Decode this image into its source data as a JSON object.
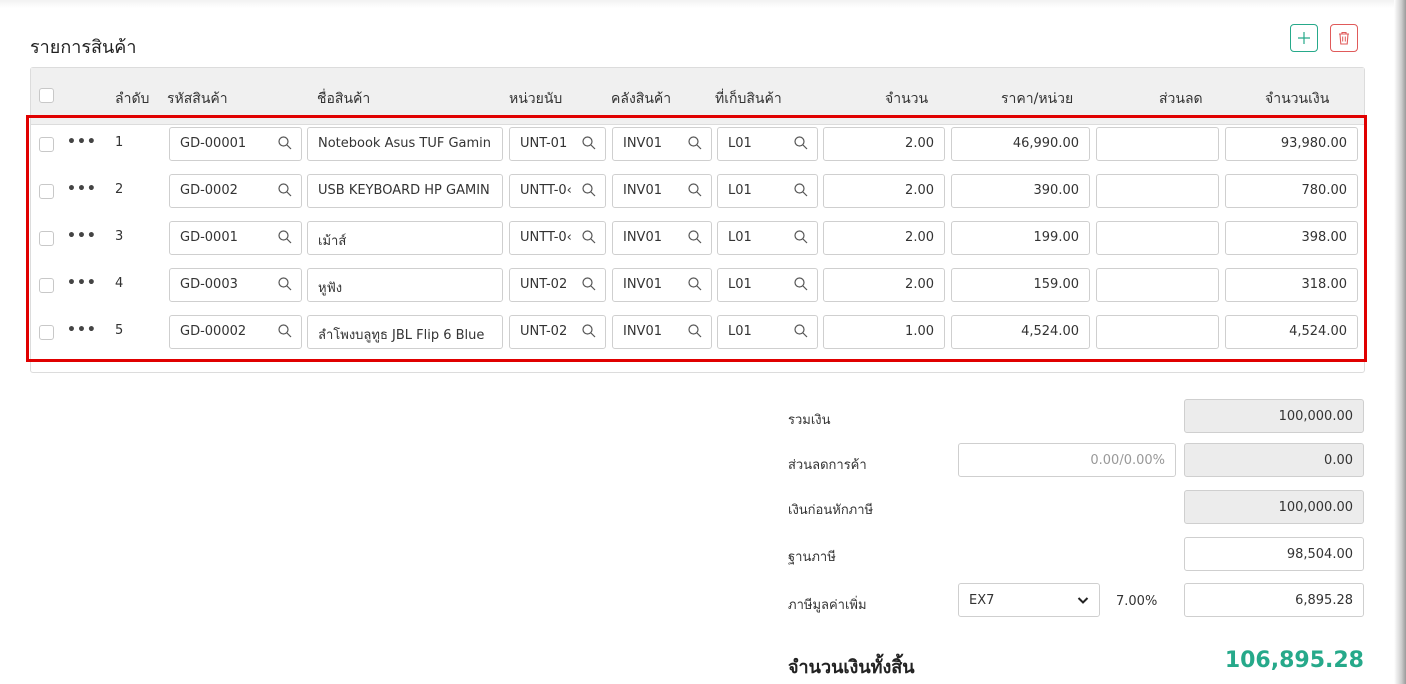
{
  "section": {
    "title": "รายการสินค้า"
  },
  "toolbar": {
    "add_icon": "plus-icon",
    "delete_icon": "trash-icon"
  },
  "table": {
    "headers": {
      "seq": "ลำดับ",
      "code": "รหัสสินค้า",
      "name": "ชื่อสินค้า",
      "unit": "หน่วยนับ",
      "warehouse": "คลังสินค้า",
      "location": "ที่เก็บสินค้า",
      "qty": "จำนวน",
      "price": "ราคา/หน่วย",
      "discount": "ส่วนลด",
      "amount": "จำนวนเงิน"
    },
    "rows": [
      {
        "seq": "1",
        "code": "GD-00001",
        "name": "Notebook Asus TUF Gamin",
        "unit": "UNT-01",
        "warehouse": "INV01",
        "location": "L01",
        "qty": "2.00",
        "price": "46,990.00",
        "discount": "",
        "amount": "93,980.00"
      },
      {
        "seq": "2",
        "code": "GD-0002",
        "name": "USB KEYBOARD HP GAMIN",
        "unit": "UNTT-0‹",
        "warehouse": "INV01",
        "location": "L01",
        "qty": "2.00",
        "price": "390.00",
        "discount": "",
        "amount": "780.00"
      },
      {
        "seq": "3",
        "code": "GD-0001",
        "name": "เม้าส์",
        "unit": "UNTT-0‹",
        "warehouse": "INV01",
        "location": "L01",
        "qty": "2.00",
        "price": "199.00",
        "discount": "",
        "amount": "398.00"
      },
      {
        "seq": "4",
        "code": "GD-0003",
        "name": "หูฟัง",
        "unit": "UNT-02",
        "warehouse": "INV01",
        "location": "L01",
        "qty": "2.00",
        "price": "159.00",
        "discount": "",
        "amount": "318.00"
      },
      {
        "seq": "5",
        "code": "GD-00002",
        "name": "ลำโพงบลูทูธ JBL Flip 6 Blue",
        "unit": "UNT-02",
        "warehouse": "INV01",
        "location": "L01",
        "qty": "1.00",
        "price": "4,524.00",
        "discount": "",
        "amount": "4,524.00"
      }
    ]
  },
  "summary": {
    "total_label": "รวมเงิน",
    "total_value": "100,000.00",
    "trade_discount_label": "ส่วนลดการค้า",
    "trade_discount_input": "0.00/0.00%",
    "trade_discount_value": "0.00",
    "before_tax_label": "เงินก่อนหักภาษี",
    "before_tax_value": "100,000.00",
    "tax_base_label": "ฐานภาษี",
    "tax_base_value": "98,504.00",
    "vat_label": "ภาษีมูลค่าเพิ่ม",
    "vat_code": "EX7",
    "vat_rate": "7.00%",
    "vat_value": "6,895.28",
    "grand_total_label": "จำนวนเงินทั้งสิ้น",
    "grand_total_value": "106,895.28"
  },
  "colors": {
    "accent": "#26a98a",
    "danger": "#e05a5a",
    "highlight": "#e00000"
  }
}
